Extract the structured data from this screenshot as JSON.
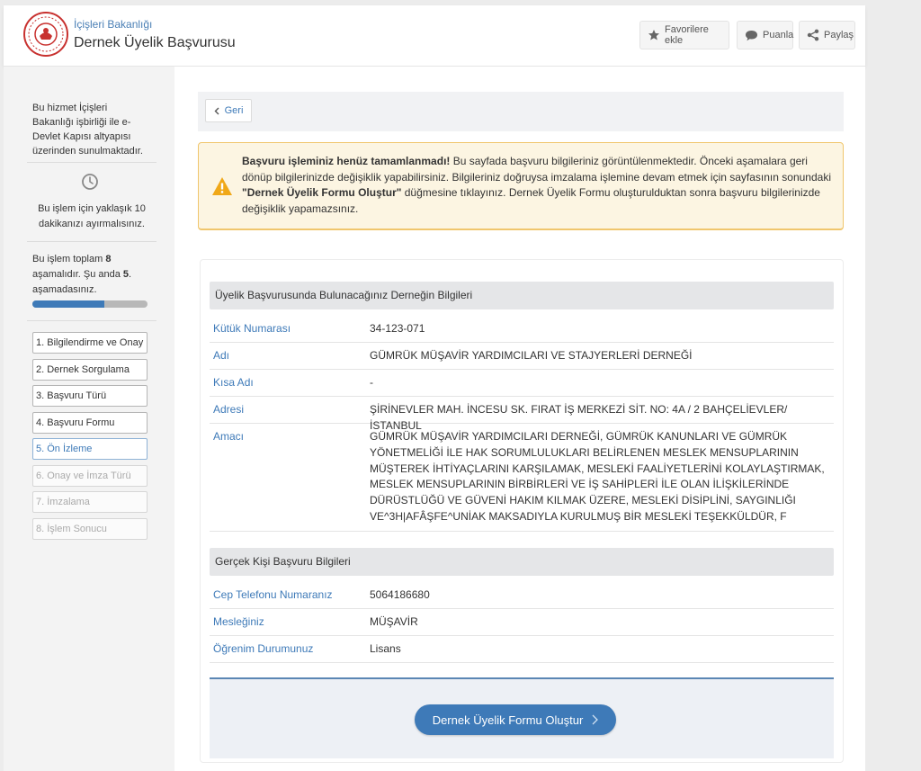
{
  "header": {
    "ministry": "İçişleri Bakanlığı",
    "title": "Dernek Üyelik Başvurusu",
    "buttons": {
      "favorite": "Favorilere ekle",
      "rate": "Puanla",
      "share": "Paylaş"
    }
  },
  "sidebar": {
    "info": "Bu hizmet İçişleri Bakanlığı işbirliği ile e-Devlet Kapısı altyapısı üzerinden sunulmaktadır.",
    "duration": "Bu işlem için yaklaşık 10 dakikanızı ayırmalısınız.",
    "stage_text": {
      "prefix": "Bu işlem toplam ",
      "total": "8",
      "middle": " aşamalıdır. Şu anda ",
      "current": "5",
      "suffix": ". aşamadasınız."
    },
    "progress": 0.625,
    "steps": [
      {
        "label": "1. Bilgilendirme ve Onay",
        "state": "done"
      },
      {
        "label": "2. Dernek Sorgulama",
        "state": "done"
      },
      {
        "label": "3. Başvuru Türü",
        "state": "done"
      },
      {
        "label": "4. Başvuru Formu",
        "state": "done"
      },
      {
        "label": "5. Ön İzleme",
        "state": "active"
      },
      {
        "label": "6. Onay ve İmza Türü",
        "state": "disabled"
      },
      {
        "label": "7. İmzalama",
        "state": "disabled"
      },
      {
        "label": "8. İşlem Sonucu",
        "state": "disabled"
      }
    ]
  },
  "main": {
    "back_label": "Geri",
    "warning": {
      "bold": "Başvuru işleminiz henüz tamamlanmadı!",
      "text1": " Bu sayfada başvuru bilgileriniz görüntülenmektedir. Önceki aşamalara geri dönüp bilgilerinizde değişiklik yapabilirsiniz. Bilgileriniz doğruysa imzalama işlemine devam etmek için sayfasının sonundaki ",
      "bold2": "\"Dernek Üyelik Formu Oluştur\"",
      "text2": " düğmesine tıklayınız. Dernek Üyelik Formu oluşturulduktan sonra başvuru bilgilerinizde değişiklik yapamazsınız."
    },
    "association": {
      "heading": "Üyelik Başvurusunda Bulunacağınız Derneğin Bilgileri",
      "rows": [
        {
          "label": "Kütük Numarası",
          "value": "34-123-071"
        },
        {
          "label": "Adı",
          "value": "GÜMRÜK MÜŞAVİR YARDIMCILARI VE STAJYERLERİ DERNEĞİ"
        },
        {
          "label": "Kısa Adı",
          "value": "-"
        },
        {
          "label": "Adresi",
          "value": "ŞİRİNEVLER MAH. İNCESU SK. FIRAT İŞ MERKEZİ SİT. NO: 4A / 2 BAHÇELİEVLER/İSTANBUL"
        },
        {
          "label": "Amacı",
          "value": "GÜMRÜK MÜŞAVİR YARDIMCILARI DERNEĞİ, GÜMRÜK KANUNLARI VE GÜMRÜK YÖNETMELİĞİ İLE HAK SORUMLULUKLARI BELİRLENEN MESLEK MENSUPLARININ MÜŞTEREK İHTİYAÇLARINI KARŞILAMAK, MESLEKİ FAALİYETLERİNİ KOLAYLAŞTIRMAK, MESLEK MENSUPLARININ BİRBİRLERİ VE İŞ SAHİPLERİ İLE OLAN İLİŞKİLERİNDE DÜRÜSTLÜĞÜ VE GÜVENİ HAKIM KILMAK ÜZERE, MESLEKİ DİSİPLİNİ, SAYGINLIĞI VE^3H|AFÂŞFE^UNİAK MAKSADIYLA KURULMUŞ BİR MESLEKİ TEŞEKKÜLDÜR, F"
        }
      ]
    },
    "person": {
      "heading": "Gerçek Kişi Başvuru Bilgileri",
      "rows": [
        {
          "label": "Cep Telefonu Numaranız",
          "value": "5064186680"
        },
        {
          "label": "Mesleğiniz",
          "value": "MÜŞAVİR"
        },
        {
          "label": "Öğrenim Durumunuz",
          "value": "Lisans"
        }
      ]
    },
    "submit_label": "Dernek Üyelik Formu Oluştur"
  },
  "colors": {
    "accent": "#3e7ab8",
    "warning_bg": "#fcf5e2",
    "warning_border": "#f0c66d",
    "warning_icon": "#f0a818"
  }
}
